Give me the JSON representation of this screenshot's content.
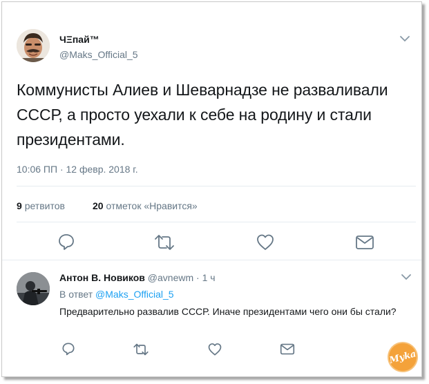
{
  "tweet": {
    "author_name": "ЧΞпай™",
    "author_handle": "@Maks_Official_5",
    "text": "Коммунисты Алиев и Шеварнадзе не разваливали СССР, а просто уехали к себе на родину и стали президентами.",
    "timestamp": "10:06 ПП · 12 февр. 2018 г.",
    "retweets_count": "9",
    "retweets_label": "ретвитов",
    "likes_count": "20",
    "likes_label": "отметок «Нравится»"
  },
  "reply": {
    "author_name": "Антон В. Новиков",
    "author_handle": "@avnewm",
    "time": "1 ч",
    "replying_to_prefix": "В ответ",
    "replying_to_handle": "@Maks_Official_5",
    "text": "Предварительно развалив СССР. Иначе президентами чего они бы стали?"
  },
  "colors": {
    "text": "#14171a",
    "muted": "#657786",
    "link": "#1da1f2",
    "divider": "#e6ecf0",
    "watermark": "#f4a23a"
  },
  "icons": {
    "reply": "reply-bubble-icon",
    "retweet": "retweet-icon",
    "like": "heart-icon",
    "message": "envelope-icon",
    "more": "chevron-down-icon"
  }
}
